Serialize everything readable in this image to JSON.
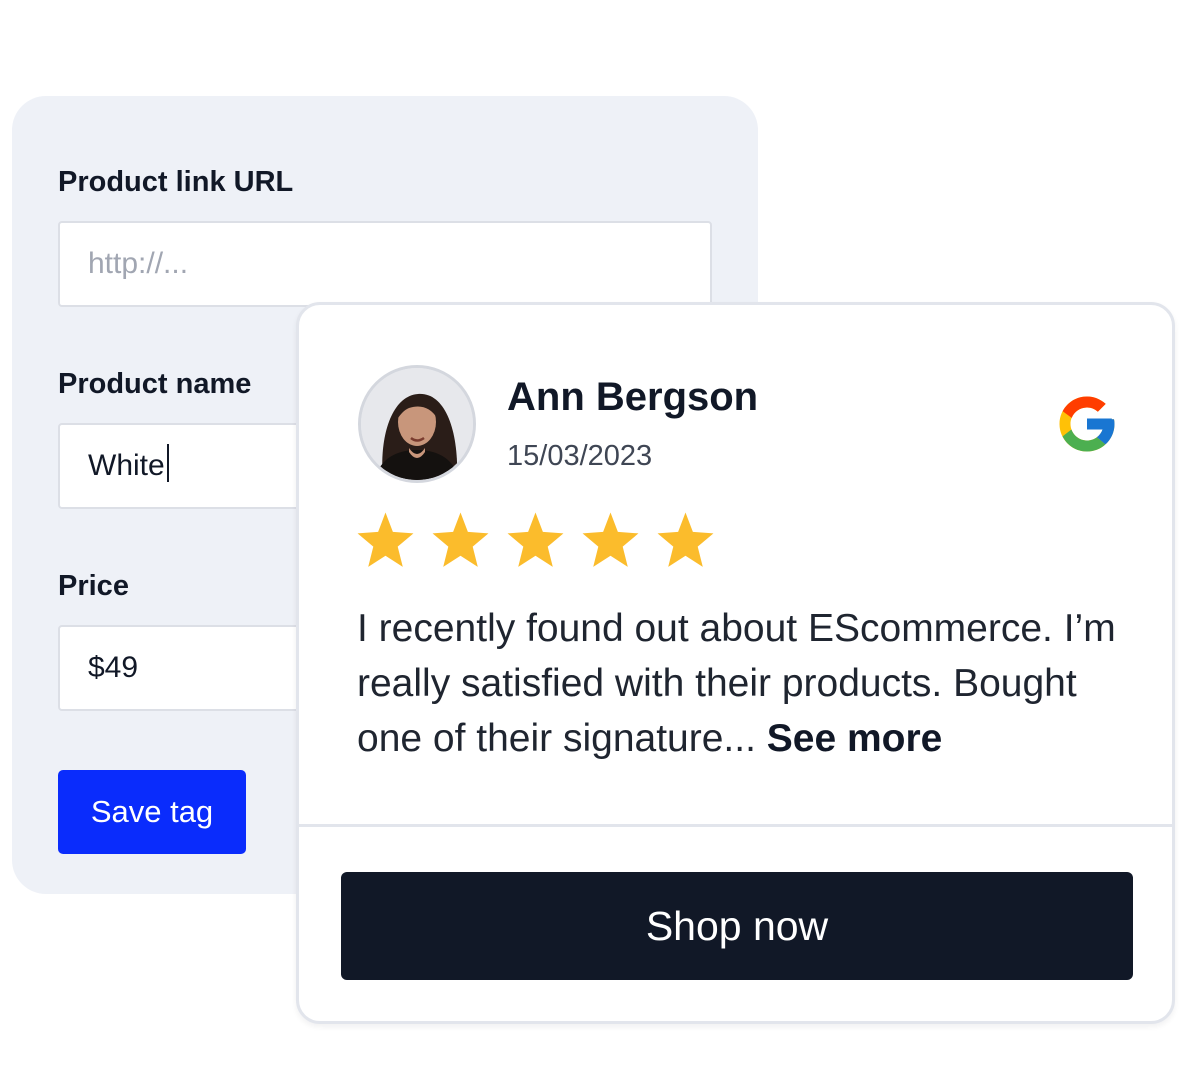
{
  "form": {
    "url_label": "Product link URL",
    "url_placeholder": "http://...",
    "name_label": "Product name",
    "name_value": "White",
    "price_label": "Price",
    "price_value": "$49",
    "save_label": "Save tag"
  },
  "review": {
    "name": "Ann Bergson",
    "date": "15/03/2023",
    "rating": 5,
    "rating_max": 5,
    "text": "I recently found out about EScommerce. I’m really satisfied with their products. Bought one of their signature...",
    "see_more_label": "See more",
    "source_icon": "google-icon",
    "cta_label": "Shop now"
  },
  "colors": {
    "panel_bg": "#eef1f7",
    "primary_button": "#0a2cfc",
    "cta_button": "#111827",
    "star": "#fbbc2c"
  }
}
